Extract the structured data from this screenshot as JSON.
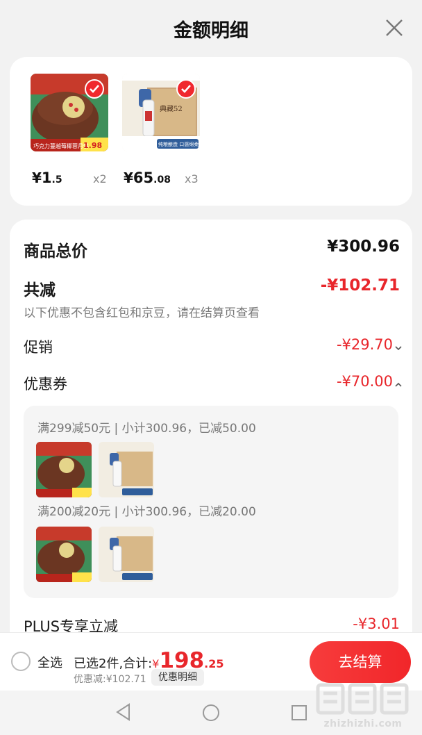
{
  "header": {
    "title": "金额明细"
  },
  "products": [
    {
      "price_symbol": "¥",
      "price_int": "1",
      "price_dec": ".5",
      "qty": "x2",
      "thumb_caption": "巧克力蔓越莓椰蓉月饼",
      "thumb_tag": "1.98"
    },
    {
      "price_symbol": "¥",
      "price_int": "65",
      "price_dec": ".08",
      "qty": "x3",
      "thumb_caption": "纯粮酿造 口感绵柔",
      "thumb_tag": "典藏52"
    }
  ],
  "summary": {
    "total_label": "商品总价",
    "total_value": "¥300.96",
    "reduce_label": "共减",
    "reduce_value": "-¥102.71",
    "note": "以下优惠不包含红包和京豆，请在结算页查看",
    "promo_label": "促销",
    "promo_value": "-¥29.70",
    "coupon_label": "优惠券",
    "coupon_value": "-¥70.00",
    "plus_label": "PLUS专享立减",
    "plus_value": "-¥3.01"
  },
  "coupons": [
    {
      "text": "满299减50元 | 小计300.96，已减50.00"
    },
    {
      "text": "满200减20元 | 小计300.96，已减20.00"
    }
  ],
  "bottom": {
    "select_all": "全选",
    "selected_text": "已选2件,合计:",
    "currency": "¥",
    "total_int": "198",
    "total_dec": ".25",
    "discount_text": "优惠减:¥102.71",
    "detail_button": "优惠明细",
    "checkout": "去结算"
  },
  "watermark": {
    "text": "zhizhizhi.com"
  },
  "colors": {
    "accent": "#e8262b",
    "button": "#f1262a"
  }
}
